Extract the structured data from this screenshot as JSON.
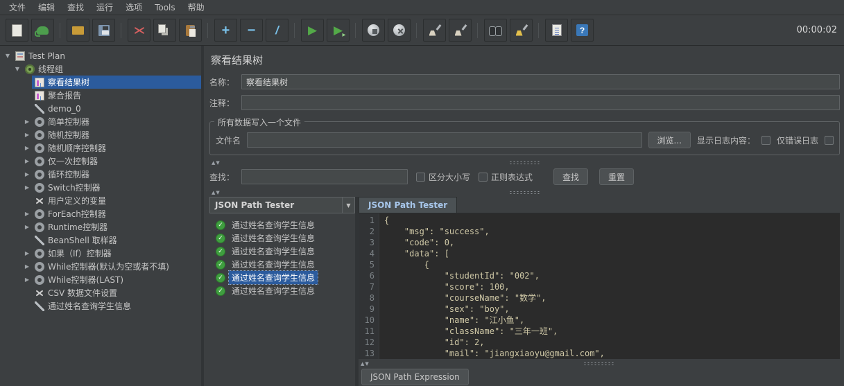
{
  "menubar": {
    "items": [
      "文件",
      "编辑",
      "查找",
      "运行",
      "选项",
      "Tools",
      "帮助"
    ]
  },
  "toolbar": {
    "timer": "00:00:02",
    "groups": [
      [
        {
          "name": "new-plan",
          "icon": "new-file-icon"
        },
        {
          "name": "templates",
          "icon": "templates-icon"
        }
      ],
      [
        {
          "name": "open",
          "icon": "open-folder-icon"
        },
        {
          "name": "save",
          "icon": "save-icon"
        }
      ],
      [
        {
          "name": "cut",
          "icon": "scissors-icon"
        },
        {
          "name": "copy",
          "icon": "copy-icon"
        },
        {
          "name": "paste",
          "icon": "paste-icon"
        }
      ],
      [
        {
          "name": "expand-all",
          "icon": "plus-icon",
          "glyph": "+"
        },
        {
          "name": "collapse-all",
          "icon": "minus-icon",
          "glyph": "−"
        },
        {
          "name": "toggle",
          "icon": "toggle-icon",
          "glyph": "/"
        }
      ],
      [
        {
          "name": "start",
          "icon": "play-icon",
          "glyph": "▶"
        },
        {
          "name": "start-no-pauses",
          "icon": "play-skip-icon",
          "glyph": "▶"
        }
      ],
      [
        {
          "name": "stop",
          "icon": "stop-icon"
        },
        {
          "name": "shutdown",
          "icon": "shutdown-icon"
        }
      ],
      [
        {
          "name": "clear",
          "icon": "broom-icon"
        },
        {
          "name": "clear-all",
          "icon": "double-broom-icon"
        }
      ],
      [
        {
          "name": "search",
          "icon": "binoculars-icon"
        },
        {
          "name": "search-reset",
          "icon": "broom-yellow-icon"
        }
      ],
      [
        {
          "name": "function-helper",
          "icon": "function-helper-icon"
        },
        {
          "name": "help",
          "icon": "help-icon",
          "glyph": "?"
        }
      ]
    ]
  },
  "tree": {
    "items": [
      {
        "label": "Test Plan",
        "level": 0,
        "expander": "open",
        "icon": "test-plan-icon"
      },
      {
        "label": "线程组",
        "level": 1,
        "expander": "open",
        "icon": "thread-group-icon"
      },
      {
        "label": "察看结果树",
        "level": 2,
        "expander": "none",
        "icon": "listener-icon",
        "selected": true
      },
      {
        "label": "聚合报告",
        "level": 2,
        "expander": "none",
        "icon": "listener-icon"
      },
      {
        "label": "demo_0",
        "level": 2,
        "expander": "none",
        "icon": "sampler-icon"
      },
      {
        "label": "简单控制器",
        "level": 2,
        "expander": "closed",
        "icon": "controller-icon"
      },
      {
        "label": "随机控制器",
        "level": 2,
        "expander": "closed",
        "icon": "controller-icon"
      },
      {
        "label": "随机顺序控制器",
        "level": 2,
        "expander": "closed",
        "icon": "controller-icon"
      },
      {
        "label": "仅一次控制器",
        "level": 2,
        "expander": "closed",
        "icon": "controller-icon"
      },
      {
        "label": "循环控制器",
        "level": 2,
        "expander": "closed",
        "icon": "controller-icon"
      },
      {
        "label": "Switch控制器",
        "level": 2,
        "expander": "closed",
        "icon": "controller-icon"
      },
      {
        "label": "用户定义的变量",
        "level": 2,
        "expander": "none",
        "icon": "config-icon"
      },
      {
        "label": "ForEach控制器",
        "level": 2,
        "expander": "closed",
        "icon": "controller-icon"
      },
      {
        "label": "Runtime控制器",
        "level": 2,
        "expander": "closed",
        "icon": "controller-icon"
      },
      {
        "label": "BeanShell 取样器",
        "level": 2,
        "expander": "none",
        "icon": "sampler-icon"
      },
      {
        "label": "如果（If）控制器",
        "level": 2,
        "expander": "closed",
        "icon": "controller-icon"
      },
      {
        "label": "While控制器(默认为空或者不填)",
        "level": 2,
        "expander": "closed",
        "icon": "controller-icon"
      },
      {
        "label": "While控制器(LAST)",
        "level": 2,
        "expander": "closed",
        "icon": "controller-icon"
      },
      {
        "label": "CSV 数据文件设置",
        "level": 2,
        "expander": "none",
        "icon": "config-icon"
      },
      {
        "label": "通过姓名查询学生信息",
        "level": 2,
        "expander": "none",
        "icon": "sampler-icon"
      }
    ]
  },
  "main": {
    "title": "察看结果树",
    "name": {
      "label": "名称：",
      "value": "察看结果树"
    },
    "comment": {
      "label": "注释：",
      "value": ""
    },
    "file_group": {
      "title": "所有数据写入一个文件",
      "filename_label": "文件名",
      "filename_value": "",
      "browse_button": "浏览...",
      "log_label": "显示日志内容：",
      "errors_only": "仅错误日志"
    },
    "search": {
      "label": "查找：",
      "value": "",
      "case_label": "区分大小写",
      "regex_label": "正则表达式",
      "find_button": "查找",
      "reset_button": "重置"
    },
    "results": {
      "renderer": "JSON Path Tester",
      "selected_index": 4,
      "items": [
        "通过姓名查询学生信息",
        "通过姓名查询学生信息",
        "通过姓名查询学生信息",
        "通过姓名查询学生信息",
        "通过姓名查询学生信息",
        "通过姓名查询学生信息"
      ]
    },
    "viewer": {
      "tab": "JSON Path Tester",
      "expression_label": "JSON Path Expression",
      "code": [
        "{",
        "    \"msg\": \"success\",",
        "    \"code\": 0,",
        "    \"data\": [",
        "        {",
        "            \"studentId\": \"002\",",
        "            \"score\": 100,",
        "            \"courseName\": \"数学\",",
        "            \"sex\": \"boy\",",
        "            \"name\": \"江小鱼\",",
        "            \"className\": \"三年一班\",",
        "            \"id\": 2,",
        "            \"mail\": \"jiangxiaoyu@gmail.com\","
      ]
    }
  }
}
